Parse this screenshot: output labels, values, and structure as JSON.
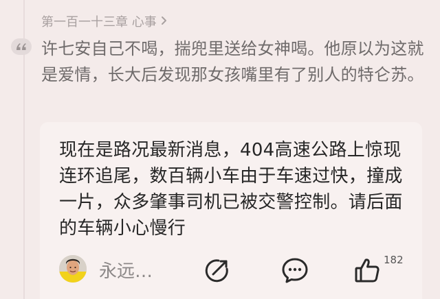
{
  "chapter": {
    "title": "第一百一十三章 心事",
    "chevron_icon": "chevron-right-icon"
  },
  "quote": {
    "icon": "quote-icon",
    "text": "许七安自己不喝，揣兜里送给女神喝。他原以为这就是爱情，长大后发现那女孩嘴里有了别人的特仑苏。"
  },
  "reply": {
    "text": "现在是路况最新消息，404高速公路上惊现连环追尾，数百辆小车由于车速过快，撞成一片，众多肇事司机已被交警控制。请后面的车辆小心慢行",
    "username": "永远…",
    "share_icon": "share-icon",
    "comment_icon": "comment-icon",
    "like_icon": "thumbs-up-icon",
    "like_count": "182"
  },
  "colors": {
    "background": "#f4ebea",
    "card": "#f8f1f0",
    "muted_text": "#a8a0a0",
    "quote_text": "#6f6b6b",
    "body_text": "#262626"
  }
}
